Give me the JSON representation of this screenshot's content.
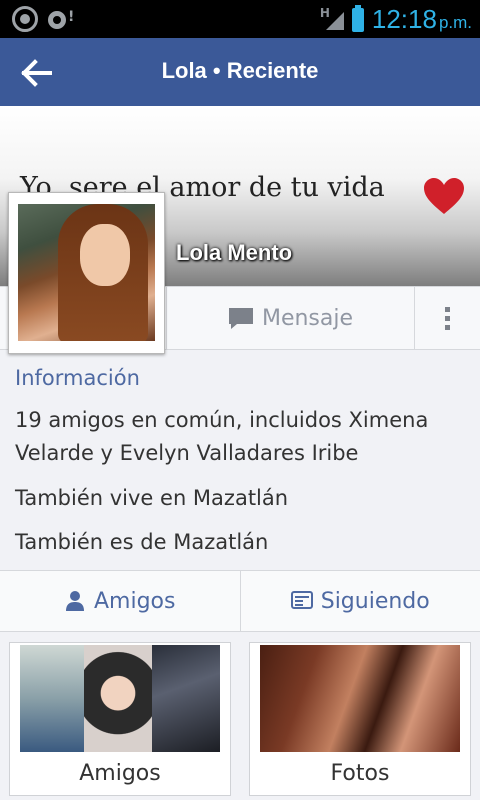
{
  "status_bar": {
    "time": "12:18",
    "ampm": "p.m.",
    "network_type": "H",
    "accent_color": "#2fb2e6",
    "icons": [
      "circle-notification-icon",
      "disc-alert-icon",
      "signal-icon",
      "battery-icon"
    ]
  },
  "app_bar": {
    "title": "Lola • Reciente",
    "background": "#3b5998",
    "back_icon": "arrow-left-icon"
  },
  "cover": {
    "quote": "Yo, sere el amor de tu vida",
    "heart_icon": "heart-icon",
    "heart_color": "#d0202a"
  },
  "profile": {
    "name": "Lola Mento"
  },
  "actions": {
    "message_label": "Mensaje",
    "message_icon": "chat-bubble-icon",
    "more_icon": "more-vertical-icon"
  },
  "info": {
    "title": "Información",
    "lines": [
      "19 amigos en común, incluidos Ximena Velarde y Evelyn Valladares Iribe",
      "También vive en Mazatlán",
      "También es de Mazatlán"
    ]
  },
  "tabs": {
    "friends_label": "Amigos",
    "friends_icon": "person-icon",
    "following_label": "Siguiendo",
    "following_icon": "feed-icon"
  },
  "cards": {
    "friends_label": "Amigos",
    "photos_label": "Fotos"
  }
}
